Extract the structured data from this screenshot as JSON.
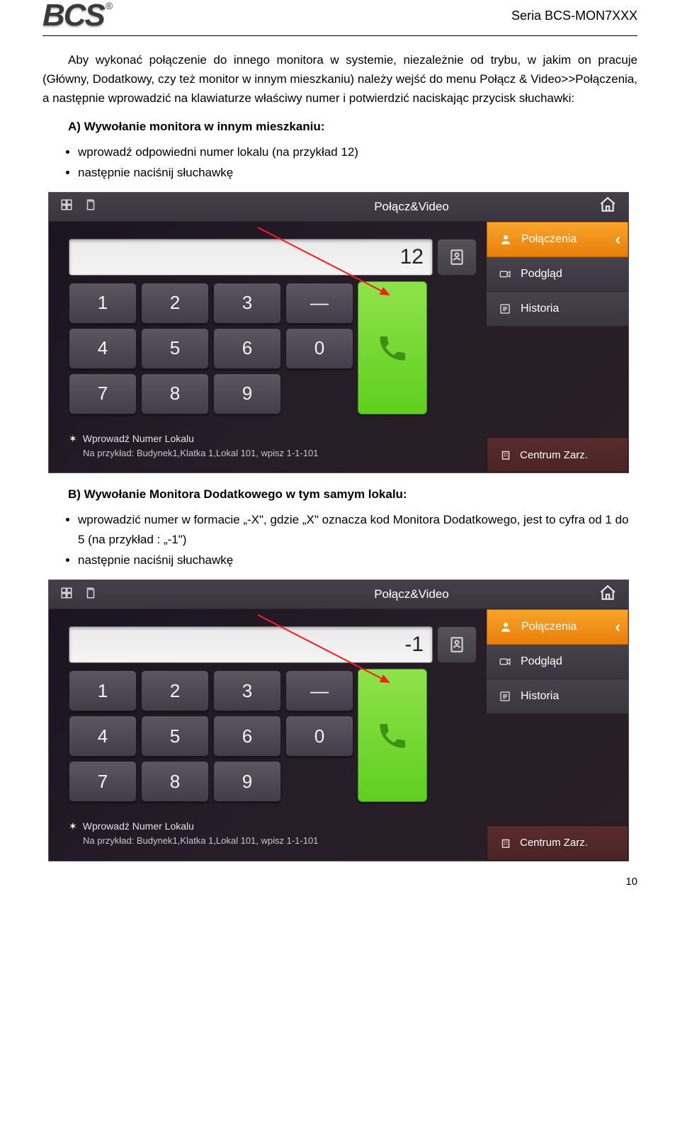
{
  "header": {
    "logo_text": "BCS",
    "logo_tm": "®",
    "series": "Seria BCS-MON7XXX"
  },
  "para1": "Aby wykonać połączenie do innego monitora w systemie, niezależnie od trybu, w jakim on pracuje (Główny, Dodatkowy, czy też monitor w innym mieszkaniu) należy wejść do menu Połącz & Video>>Połączenia, a następnie wprowadzić na klawiaturze właściwy numer i potwierdzić naciskając przycisk słuchawki:",
  "sectionA": "A) Wywołanie monitora w innym mieszkaniu:",
  "bulletsA": [
    "wprowadź odpowiedni numer lokalu (na przykład 12)",
    "następnie naciśnij słuchawkę"
  ],
  "sectionB": "B) Wywołanie Monitora Dodatkowego w tym samym lokalu:",
  "bulletsB": [
    "wprowadzić numer w formacie „-X\", gdzie „X\" oznacza kod Monitora Dodatkowego, jest to cyfra od 1 do 5 (na przykład : „-1\")",
    "następnie naciśnij słuchawkę"
  ],
  "ui": {
    "title": "Połącz&Video",
    "menu": {
      "connections": "Połączenia",
      "preview": "Podgląd",
      "history": "Historia",
      "bottom": "Centrum Zarz."
    },
    "keypad": [
      "1",
      "2",
      "3",
      "—",
      "4",
      "5",
      "6",
      "0",
      "7",
      "8",
      "9"
    ],
    "hint_title": "Wprowadź Numer Lokalu",
    "hint_sub": "Na przykład: Budynek1,Klatka 1,Lokal 101, wpisz 1-1-101"
  },
  "shotA": {
    "display": "12"
  },
  "shotB": {
    "display": "-1"
  },
  "page_number": "10"
}
